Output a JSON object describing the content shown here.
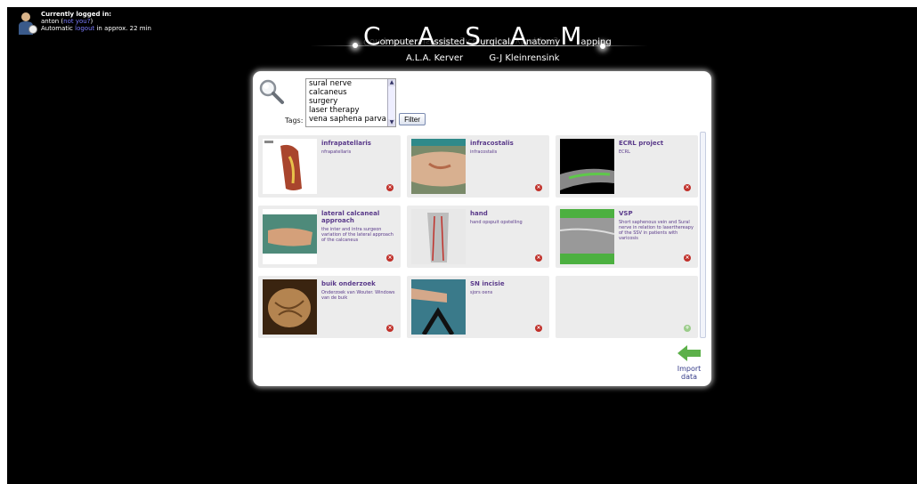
{
  "login": {
    "heading": "Currently logged in:",
    "user": "anton",
    "paren_open": " (",
    "not_you": "not you?",
    "paren_close": ")",
    "auto_pre": "Automatic ",
    "logout_link": "logout",
    "auto_post": " in approx. 22 min"
  },
  "header": {
    "title_parts": [
      {
        "c": "C",
        "big": true
      },
      {
        "c": "omputer",
        "big": false
      },
      {
        "c": "A",
        "big": true
      },
      {
        "c": "ssisted",
        "big": false
      },
      {
        "c": "S",
        "big": true
      },
      {
        "c": "urgical",
        "big": false
      },
      {
        "c": "A",
        "big": true
      },
      {
        "c": "natomy",
        "big": false
      },
      {
        "c": "M",
        "big": true
      },
      {
        "c": "apping",
        "big": false
      }
    ],
    "authors": [
      "A.L.A. Kerver",
      "G-J Kleinrensink"
    ]
  },
  "filter": {
    "tags_label": "Tags:",
    "options": [
      "sural nerve",
      "calcaneus",
      "surgery",
      "laser therapy",
      "vena saphena parva"
    ],
    "button": "Filter"
  },
  "cards": [
    {
      "title": "infrapatellaris",
      "desc": "nfrapatellaris",
      "thumb": "leg-knee"
    },
    {
      "title": "infracostalis",
      "desc": "infracostalis",
      "thumb": "torso-surgery"
    },
    {
      "title": "ECRL project",
      "desc": "ECRL",
      "thumb": "ct-scan"
    },
    {
      "title": "lateral calcaneal approach",
      "desc": "the inter and intra surgeon variation of the lateral approach of the calcaneus",
      "thumb": "foot-surgery"
    },
    {
      "title": "hand",
      "desc": "hand opspuit opstelling",
      "thumb": "hand-xray"
    },
    {
      "title": "VSP",
      "desc": "Short saphenous vein and Sural nerve in relation to laserthereapy of the SSV in patients with varicosis",
      "thumb": "leg-ultrasound"
    },
    {
      "title": "buik onderzoek",
      "desc": "Onderzoek van Wouter. Windows van de buik",
      "thumb": "abdomen"
    },
    {
      "title": "SN incisie",
      "desc": "sjors oens",
      "thumb": "sn-incision"
    }
  ],
  "import": {
    "label_1": "Import",
    "label_2": "data"
  },
  "icons": {
    "user": "user-avatar-icon",
    "clock": "clock-icon",
    "search": "magnifier-icon",
    "delete": "delete-icon",
    "add": "add-icon",
    "import": "green-arrow-left-icon"
  }
}
